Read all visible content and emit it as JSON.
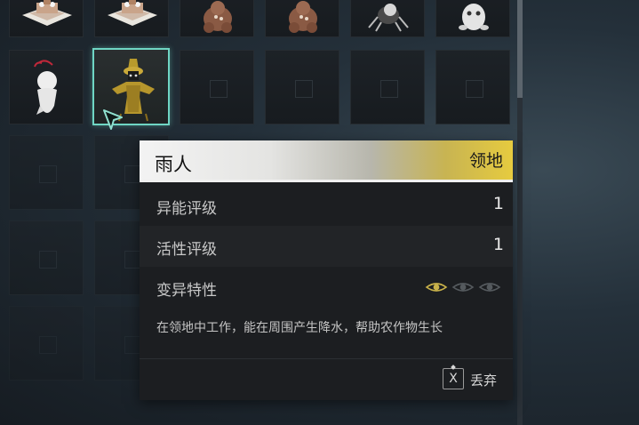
{
  "inventory": {
    "slots": [
      {
        "icon": "cake-house-icon"
      },
      {
        "icon": "cake-house-icon"
      },
      {
        "icon": "teddy-bear-icon"
      },
      {
        "icon": "teddy-bear-icon"
      },
      {
        "icon": "spider-creature-icon"
      },
      {
        "icon": "ghost-creature-icon"
      },
      {
        "icon": "white-doll-icon"
      },
      {
        "icon": "rain-person-icon",
        "selected": true
      }
    ],
    "accent_color": "#6fd6c4"
  },
  "tooltip": {
    "title": "雨人",
    "tag": "领地",
    "stats": [
      {
        "label": "异能评级",
        "value": "1"
      },
      {
        "label": "活性评级",
        "value": "1"
      },
      {
        "label": "变异特性",
        "value": ""
      }
    ],
    "mutation_eyes": {
      "active": 1,
      "total": 3,
      "active_color": "#c9b24a"
    },
    "description": "在领地中工作，能在周围产生降水，帮助农作物生长",
    "discard": {
      "key": "X",
      "label": "丢弃"
    },
    "header_accent_color": "#e6cb3f"
  }
}
